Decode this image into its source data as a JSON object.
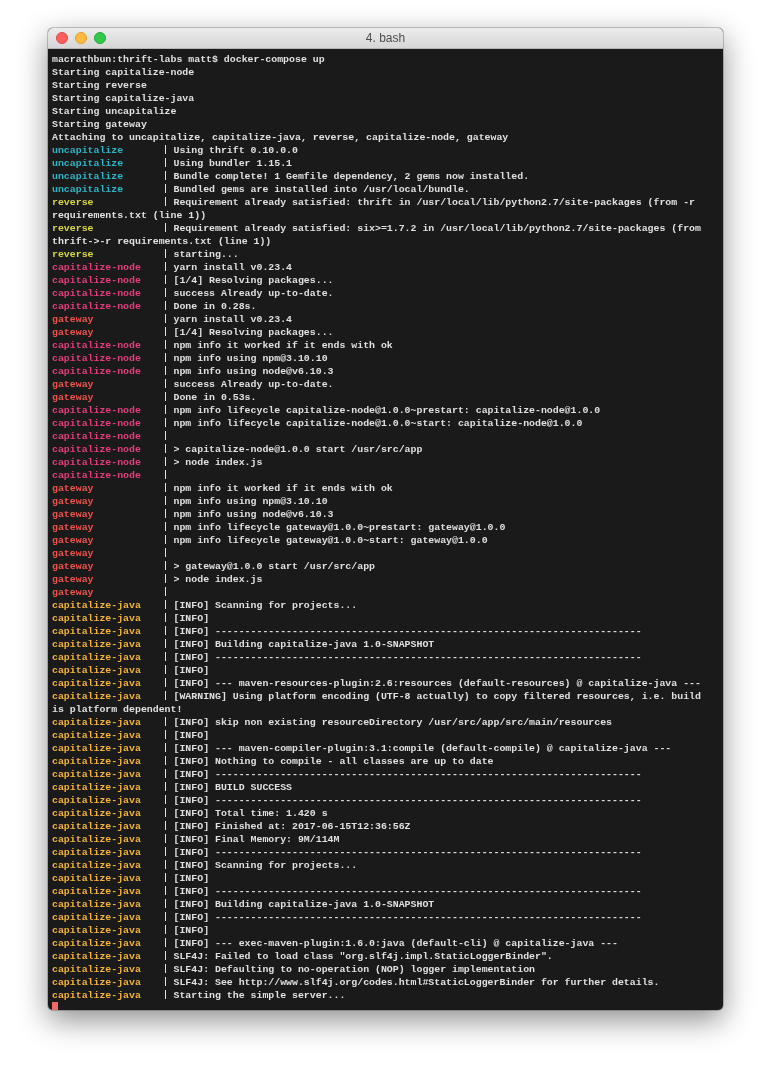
{
  "window": {
    "title": "4. bash"
  },
  "lines": [
    {
      "kind": "plain",
      "text": "macrathbun:thrift-labs matt$ docker-compose up"
    },
    {
      "kind": "plain",
      "text": "Starting capitalize-node"
    },
    {
      "kind": "plain",
      "text": "Starting reverse"
    },
    {
      "kind": "plain",
      "text": "Starting capitalize-java"
    },
    {
      "kind": "plain",
      "text": "Starting uncapitalize"
    },
    {
      "kind": "plain",
      "text": "Starting gateway"
    },
    {
      "kind": "plain",
      "text": "Attaching to uncapitalize, capitalize-java, reverse, capitalize-node, gateway"
    },
    {
      "kind": "log",
      "service": "uncapitalize",
      "color": "#2bb5c8",
      "message": "Using thrift 0.10.0.0"
    },
    {
      "kind": "log",
      "service": "uncapitalize",
      "color": "#2bb5c8",
      "message": "Using bundler 1.15.1"
    },
    {
      "kind": "log",
      "service": "uncapitalize",
      "color": "#2bb5c8",
      "message": "Bundle complete! 1 Gemfile dependency, 2 gems now installed."
    },
    {
      "kind": "log",
      "service": "uncapitalize",
      "color": "#2bb5c8",
      "message": "Bundled gems are installed into /usr/local/bundle."
    },
    {
      "kind": "log",
      "service": "reverse",
      "color": "#d6d63c",
      "message": "Requirement already satisfied: thrift in /usr/local/lib/python2.7/site-packages (from -r",
      "continuation": "requirements.txt (line 1))"
    },
    {
      "kind": "log",
      "service": "reverse",
      "color": "#d6d63c",
      "message": "Requirement already satisfied: six>=1.7.2 in /usr/local/lib/python2.7/site-packages (from",
      "continuation": "thrift->-r requirements.txt (line 1))"
    },
    {
      "kind": "log",
      "service": "reverse",
      "color": "#d6d63c",
      "message": "starting..."
    },
    {
      "kind": "log",
      "service": "capitalize-node",
      "color": "#e33d7c",
      "message": "yarn install v0.23.4"
    },
    {
      "kind": "log",
      "service": "capitalize-node",
      "color": "#e33d7c",
      "message": "[1/4] Resolving packages..."
    },
    {
      "kind": "log",
      "service": "capitalize-node",
      "color": "#e33d7c",
      "message": "success Already up-to-date."
    },
    {
      "kind": "log",
      "service": "capitalize-node",
      "color": "#e33d7c",
      "message": "Done in 0.28s."
    },
    {
      "kind": "log",
      "service": "gateway",
      "color": "#f0524d",
      "message": "yarn install v0.23.4"
    },
    {
      "kind": "log",
      "service": "gateway",
      "color": "#f0524d",
      "message": "[1/4] Resolving packages..."
    },
    {
      "kind": "log",
      "service": "capitalize-node",
      "color": "#e33d7c",
      "message": "npm info it worked if it ends with ok"
    },
    {
      "kind": "log",
      "service": "capitalize-node",
      "color": "#e33d7c",
      "message": "npm info using npm@3.10.10"
    },
    {
      "kind": "log",
      "service": "capitalize-node",
      "color": "#e33d7c",
      "message": "npm info using node@v6.10.3"
    },
    {
      "kind": "log",
      "service": "gateway",
      "color": "#f0524d",
      "message": "success Already up-to-date."
    },
    {
      "kind": "log",
      "service": "gateway",
      "color": "#f0524d",
      "message": "Done in 0.53s."
    },
    {
      "kind": "log",
      "service": "capitalize-node",
      "color": "#e33d7c",
      "message": "npm info lifecycle capitalize-node@1.0.0~prestart: capitalize-node@1.0.0"
    },
    {
      "kind": "log",
      "service": "capitalize-node",
      "color": "#e33d7c",
      "message": "npm info lifecycle capitalize-node@1.0.0~start: capitalize-node@1.0.0"
    },
    {
      "kind": "log",
      "service": "capitalize-node",
      "color": "#e33d7c"
    },
    {
      "kind": "log",
      "service": "capitalize-node",
      "color": "#e33d7c",
      "message": "> capitalize-node@1.0.0 start /usr/src/app"
    },
    {
      "kind": "log",
      "service": "capitalize-node",
      "color": "#e33d7c",
      "message": "> node index.js"
    },
    {
      "kind": "log",
      "service": "capitalize-node",
      "color": "#e33d7c"
    },
    {
      "kind": "log",
      "service": "gateway",
      "color": "#f0524d",
      "message": "npm info it worked if it ends with ok"
    },
    {
      "kind": "log",
      "service": "gateway",
      "color": "#f0524d",
      "message": "npm info using npm@3.10.10"
    },
    {
      "kind": "log",
      "service": "gateway",
      "color": "#f0524d",
      "message": "npm info using node@v6.10.3"
    },
    {
      "kind": "log",
      "service": "gateway",
      "color": "#f0524d",
      "message": "npm info lifecycle gateway@1.0.0~prestart: gateway@1.0.0"
    },
    {
      "kind": "log",
      "service": "gateway",
      "color": "#f0524d",
      "message": "npm info lifecycle gateway@1.0.0~start: gateway@1.0.0"
    },
    {
      "kind": "log",
      "service": "gateway",
      "color": "#f0524d"
    },
    {
      "kind": "log",
      "service": "gateway",
      "color": "#f0524d",
      "message": "> gateway@1.0.0 start /usr/src/app"
    },
    {
      "kind": "log",
      "service": "gateway",
      "color": "#f0524d",
      "message": "> node index.js"
    },
    {
      "kind": "log",
      "service": "gateway",
      "color": "#f0524d"
    },
    {
      "kind": "log",
      "service": "capitalize-java",
      "color": "#f2b43a",
      "message": "[INFO] Scanning for projects..."
    },
    {
      "kind": "log",
      "service": "capitalize-java",
      "color": "#f2b43a",
      "message": "[INFO]"
    },
    {
      "kind": "log",
      "service": "capitalize-java",
      "color": "#f2b43a",
      "message": "[INFO] ------------------------------------------------------------------------"
    },
    {
      "kind": "log",
      "service": "capitalize-java",
      "color": "#f2b43a",
      "message": "[INFO] Building capitalize-java 1.0-SNAPSHOT"
    },
    {
      "kind": "log",
      "service": "capitalize-java",
      "color": "#f2b43a",
      "message": "[INFO] ------------------------------------------------------------------------"
    },
    {
      "kind": "log",
      "service": "capitalize-java",
      "color": "#f2b43a",
      "message": "[INFO]"
    },
    {
      "kind": "log",
      "service": "capitalize-java",
      "color": "#f2b43a",
      "message": "[INFO] --- maven-resources-plugin:2.6:resources (default-resources) @ capitalize-java ---"
    },
    {
      "kind": "log",
      "service": "capitalize-java",
      "color": "#f2b43a",
      "message": "[WARNING] Using platform encoding (UTF-8 actually) to copy filtered resources, i.e. build",
      "continuation": "is platform dependent!"
    },
    {
      "kind": "log",
      "service": "capitalize-java",
      "color": "#f2b43a",
      "message": "[INFO] skip non existing resourceDirectory /usr/src/app/src/main/resources"
    },
    {
      "kind": "log",
      "service": "capitalize-java",
      "color": "#f2b43a",
      "message": "[INFO]"
    },
    {
      "kind": "log",
      "service": "capitalize-java",
      "color": "#f2b43a",
      "message": "[INFO] --- maven-compiler-plugin:3.1:compile (default-compile) @ capitalize-java ---"
    },
    {
      "kind": "log",
      "service": "capitalize-java",
      "color": "#f2b43a",
      "message": "[INFO] Nothing to compile - all classes are up to date"
    },
    {
      "kind": "log",
      "service": "capitalize-java",
      "color": "#f2b43a",
      "message": "[INFO] ------------------------------------------------------------------------"
    },
    {
      "kind": "log",
      "service": "capitalize-java",
      "color": "#f2b43a",
      "message": "[INFO] BUILD SUCCESS"
    },
    {
      "kind": "log",
      "service": "capitalize-java",
      "color": "#f2b43a",
      "message": "[INFO] ------------------------------------------------------------------------"
    },
    {
      "kind": "log",
      "service": "capitalize-java",
      "color": "#f2b43a",
      "message": "[INFO] Total time: 1.420 s"
    },
    {
      "kind": "log",
      "service": "capitalize-java",
      "color": "#f2b43a",
      "message": "[INFO] Finished at: 2017-06-15T12:36:56Z"
    },
    {
      "kind": "log",
      "service": "capitalize-java",
      "color": "#f2b43a",
      "message": "[INFO] Final Memory: 9M/114M"
    },
    {
      "kind": "log",
      "service": "capitalize-java",
      "color": "#f2b43a",
      "message": "[INFO] ------------------------------------------------------------------------"
    },
    {
      "kind": "log",
      "service": "capitalize-java",
      "color": "#f2b43a",
      "message": "[INFO] Scanning for projects..."
    },
    {
      "kind": "log",
      "service": "capitalize-java",
      "color": "#f2b43a",
      "message": "[INFO]"
    },
    {
      "kind": "log",
      "service": "capitalize-java",
      "color": "#f2b43a",
      "message": "[INFO] ------------------------------------------------------------------------"
    },
    {
      "kind": "log",
      "service": "capitalize-java",
      "color": "#f2b43a",
      "message": "[INFO] Building capitalize-java 1.0-SNAPSHOT"
    },
    {
      "kind": "log",
      "service": "capitalize-java",
      "color": "#f2b43a",
      "message": "[INFO] ------------------------------------------------------------------------"
    },
    {
      "kind": "log",
      "service": "capitalize-java",
      "color": "#f2b43a",
      "message": "[INFO]"
    },
    {
      "kind": "log",
      "service": "capitalize-java",
      "color": "#f2b43a",
      "message": "[INFO] --- exec-maven-plugin:1.6.0:java (default-cli) @ capitalize-java ---"
    },
    {
      "kind": "log",
      "service": "capitalize-java",
      "color": "#f2b43a",
      "message": "SLF4J: Failed to load class \"org.slf4j.impl.StaticLoggerBinder\"."
    },
    {
      "kind": "log",
      "service": "capitalize-java",
      "color": "#f2b43a",
      "message": "SLF4J: Defaulting to no-operation (NOP) logger implementation"
    },
    {
      "kind": "log",
      "service": "capitalize-java",
      "color": "#f2b43a",
      "message": "SLF4J: See http://www.slf4j.org/codes.html#StaticLoggerBinder for further details."
    },
    {
      "kind": "log",
      "service": "capitalize-java",
      "color": "#f2b43a",
      "message": "Starting the simple server..."
    }
  ]
}
